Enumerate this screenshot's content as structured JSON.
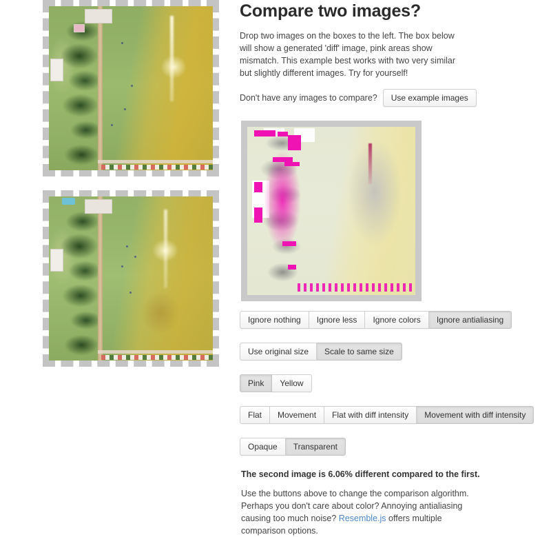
{
  "header": {
    "title": "Compare two images?",
    "description": "Drop two images on the boxes to the left. The box below will show a generated 'diff' image, pink areas show mismatch. This example best works with two very similar but slightly different images. Try for yourself!",
    "example_prompt": "Don't have any images to compare?",
    "example_button": "Use example images"
  },
  "dropzones": [
    {
      "name": "first-image-dropzone",
      "alt": "Aerial photograph of a park with trees, a path and a large grass field"
    },
    {
      "name": "second-image-dropzone",
      "alt": "Second aerial photograph of the same park, slightly different"
    }
  ],
  "diff": {
    "alt": "Generated diff image, pink areas show mismatch",
    "frame_color": "#c9c9c9",
    "mismatch_color": "#ef13b4"
  },
  "controls": {
    "groups": [
      {
        "name": "ignore-options",
        "buttons": [
          {
            "label": "Ignore nothing",
            "active": false
          },
          {
            "label": "Ignore less",
            "active": false
          },
          {
            "label": "Ignore colors",
            "active": false
          },
          {
            "label": "Ignore antialiasing",
            "active": true
          }
        ]
      },
      {
        "name": "size-options",
        "buttons": [
          {
            "label": "Use original size",
            "active": false
          },
          {
            "label": "Scale to same size",
            "active": true
          }
        ]
      },
      {
        "name": "color-options",
        "buttons": [
          {
            "label": "Pink",
            "active": true
          },
          {
            "label": "Yellow",
            "active": false
          }
        ]
      },
      {
        "name": "output-style-options",
        "buttons": [
          {
            "label": "Flat",
            "active": false
          },
          {
            "label": "Movement",
            "active": false
          },
          {
            "label": "Flat with diff intensity",
            "active": false
          },
          {
            "label": "Movement with diff intensity",
            "active": true
          }
        ]
      },
      {
        "name": "opacity-options",
        "buttons": [
          {
            "label": "Opaque",
            "active": false
          },
          {
            "label": "Transparent",
            "active": true
          }
        ]
      }
    ]
  },
  "result": {
    "text": "The second image is 6.06% different compared to the first.",
    "percent": "6.06%"
  },
  "footnote": {
    "before": "Use the buttons above to change the comparison algorithm. Perhaps you don't care about color? Annoying antialiasing causing too much noise? ",
    "link": "Resemble.js",
    "after": " offers multiple comparison options."
  }
}
